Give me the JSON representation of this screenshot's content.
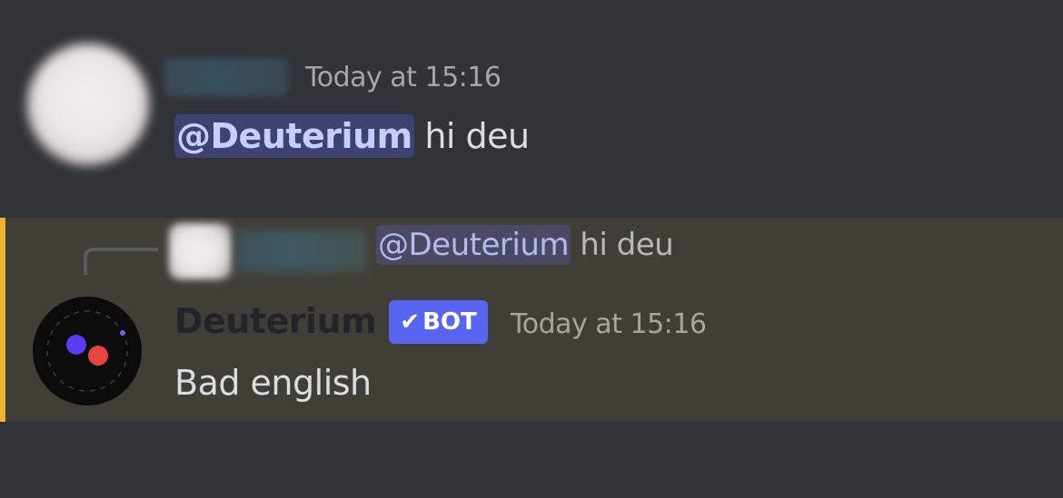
{
  "first_message": {
    "timestamp": "Today at 15:16",
    "mention": "@Deuterium",
    "text": " hi deu"
  },
  "reply_preview": {
    "mention": "@Deuterium",
    "text": " hi deu"
  },
  "bot_message": {
    "username": "Deuterium",
    "bot_tag": "BOT",
    "check_icon": "✔",
    "timestamp": "Today at 15:16",
    "text": "Bad english"
  },
  "colors": {
    "background": "#313338",
    "highlight_background": "#403f37",
    "highlight_bar": "#f0b232",
    "mention_background": "#3e4270",
    "mention_text": "#c9cdfb",
    "bot_tag": "#5865f2",
    "avatar_dot_blue": "#5b3cf0",
    "avatar_dot_red": "#e4463f"
  },
  "icons": {
    "bot_verified": "check-icon"
  }
}
